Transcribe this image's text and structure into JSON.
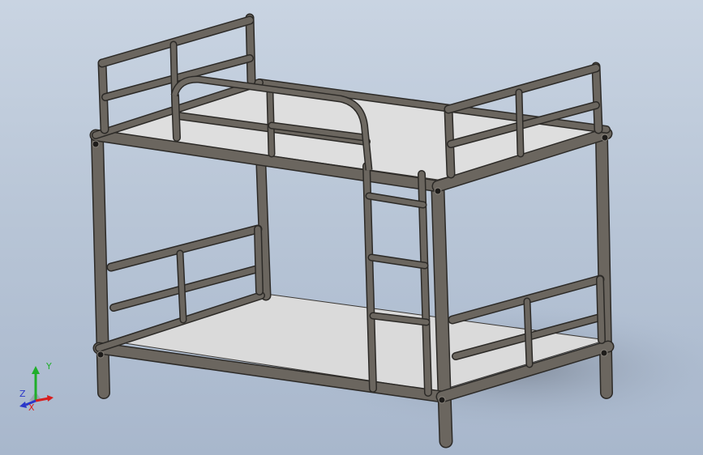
{
  "viewport": {
    "colors": {
      "background_top": "#c9d4e2",
      "background_bottom": "#a8b7cc",
      "frame": "#6b665f",
      "frame_edge": "#2c2a27",
      "deck": "#dcdcdc",
      "shadow": "#8c96a4"
    }
  },
  "triad": {
    "x_label": "X",
    "y_label": "Y",
    "z_label": "Z",
    "colors": {
      "x": "#d81e1e",
      "y": "#1fae2a",
      "z": "#2b37c9"
    }
  }
}
